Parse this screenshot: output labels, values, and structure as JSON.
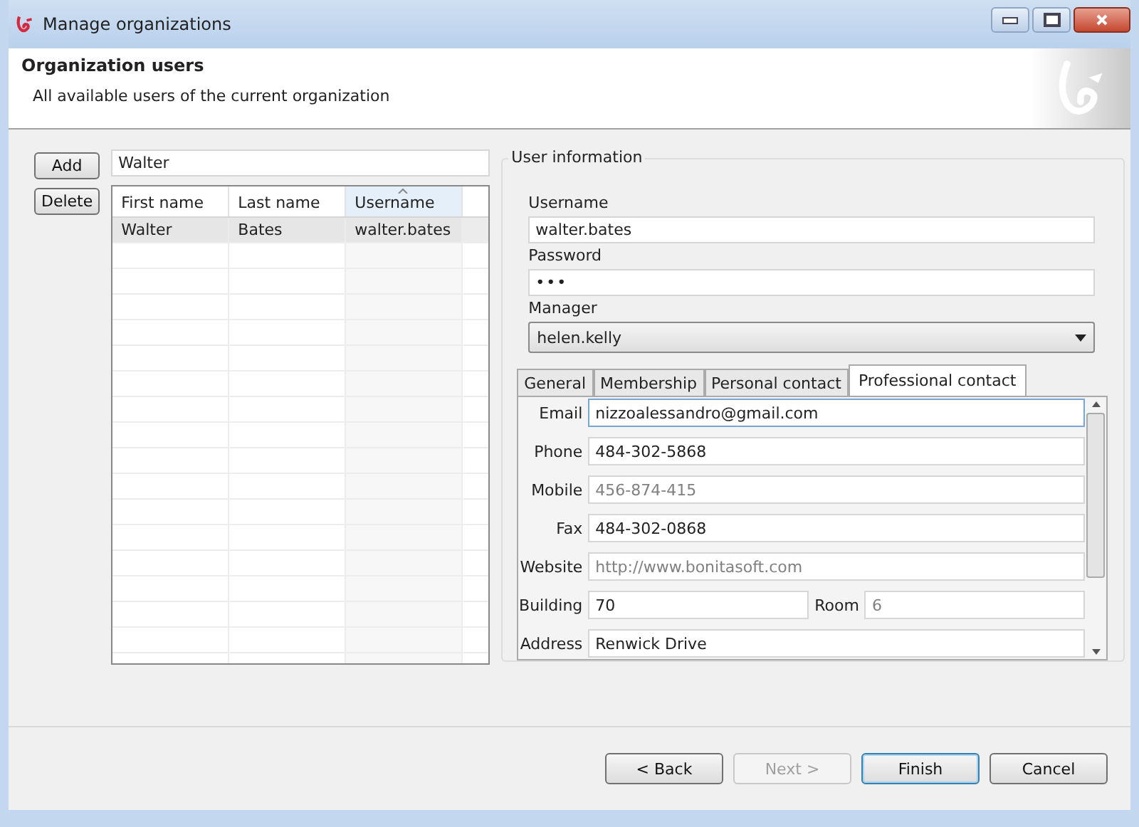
{
  "window": {
    "title": "Manage organizations"
  },
  "header": {
    "title": "Organization users",
    "subtitle": "All available users of the current organization"
  },
  "list_buttons": [
    "Add",
    "Delete"
  ],
  "filter": {
    "value": "Walter"
  },
  "table": {
    "columns": [
      {
        "label": "First name",
        "sorted": false
      },
      {
        "label": "Last name",
        "sorted": false
      },
      {
        "label": "Username",
        "sorted": true
      }
    ],
    "rows": [
      {
        "cells": [
          "Walter",
          "Bates",
          "walter.bates"
        ],
        "selected": true
      }
    ]
  },
  "user_info": {
    "title": "User information",
    "username": {
      "label": "Username",
      "value": "walter.bates"
    },
    "password": {
      "label": "Password",
      "value": "•••"
    },
    "manager": {
      "label": "Manager",
      "value": "helen.kelly"
    }
  },
  "tabs": [
    {
      "label": "General",
      "selected": false
    },
    {
      "label": "Membership",
      "selected": false
    },
    {
      "label": "Personal contact",
      "selected": false
    },
    {
      "label": "Professional contact",
      "selected": true
    }
  ],
  "contact_fields": [
    {
      "kind": "single",
      "label": "Email",
      "value": "nizzoalessandro@gmail.com",
      "focused": true
    },
    {
      "kind": "single",
      "label": "Phone",
      "value": "484-302-5868",
      "focused": false
    },
    {
      "kind": "single",
      "label": "Mobile",
      "placeholder": "456-874-415",
      "focused": false
    },
    {
      "kind": "single",
      "label": "Fax",
      "value": "484-302-0868",
      "focused": false
    },
    {
      "kind": "single",
      "label": "Website",
      "placeholder": "http://www.bonitasoft.com",
      "focused": false
    },
    {
      "kind": "pair",
      "label": "Building",
      "value": "70",
      "label2": "Room",
      "placeholder2": "6"
    },
    {
      "kind": "single",
      "label": "Address",
      "value": "Renwick Drive",
      "focused": false
    }
  ],
  "footer_buttons": [
    {
      "label": "< Back",
      "disabled": false,
      "default": false
    },
    {
      "label": "Next >",
      "disabled": true,
      "default": false
    },
    {
      "label": "Finish",
      "disabled": false,
      "default": true
    },
    {
      "label": "Cancel",
      "disabled": false,
      "default": false
    }
  ]
}
